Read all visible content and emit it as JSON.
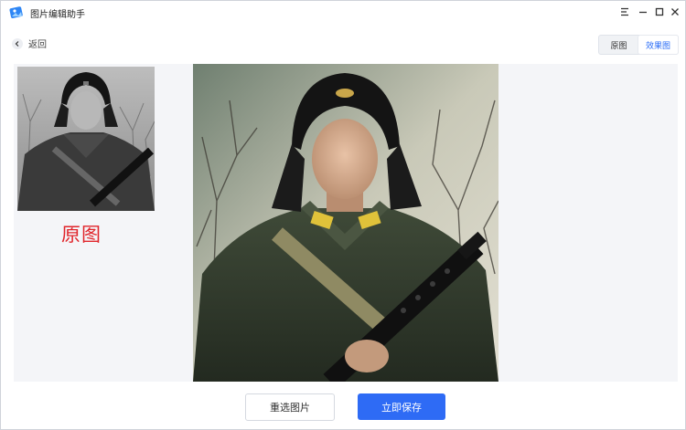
{
  "app": {
    "title": "图片编辑助手"
  },
  "titlebar": {
    "icons": [
      "app-logo-icon",
      "menu-icon",
      "minimize-icon",
      "maximize-icon",
      "close-icon"
    ]
  },
  "toolbar": {
    "back_label": "返回",
    "view_toggle": {
      "options": [
        "原图",
        "效果图"
      ],
      "selected": "效果图"
    }
  },
  "preview": {
    "original_caption": "原图"
  },
  "actions": {
    "reselect_label": "重选图片",
    "save_label": "立即保存"
  },
  "colors": {
    "accent": "#2e6bf5",
    "caption_red": "#e0252b",
    "content_bg": "#f4f5f8"
  }
}
